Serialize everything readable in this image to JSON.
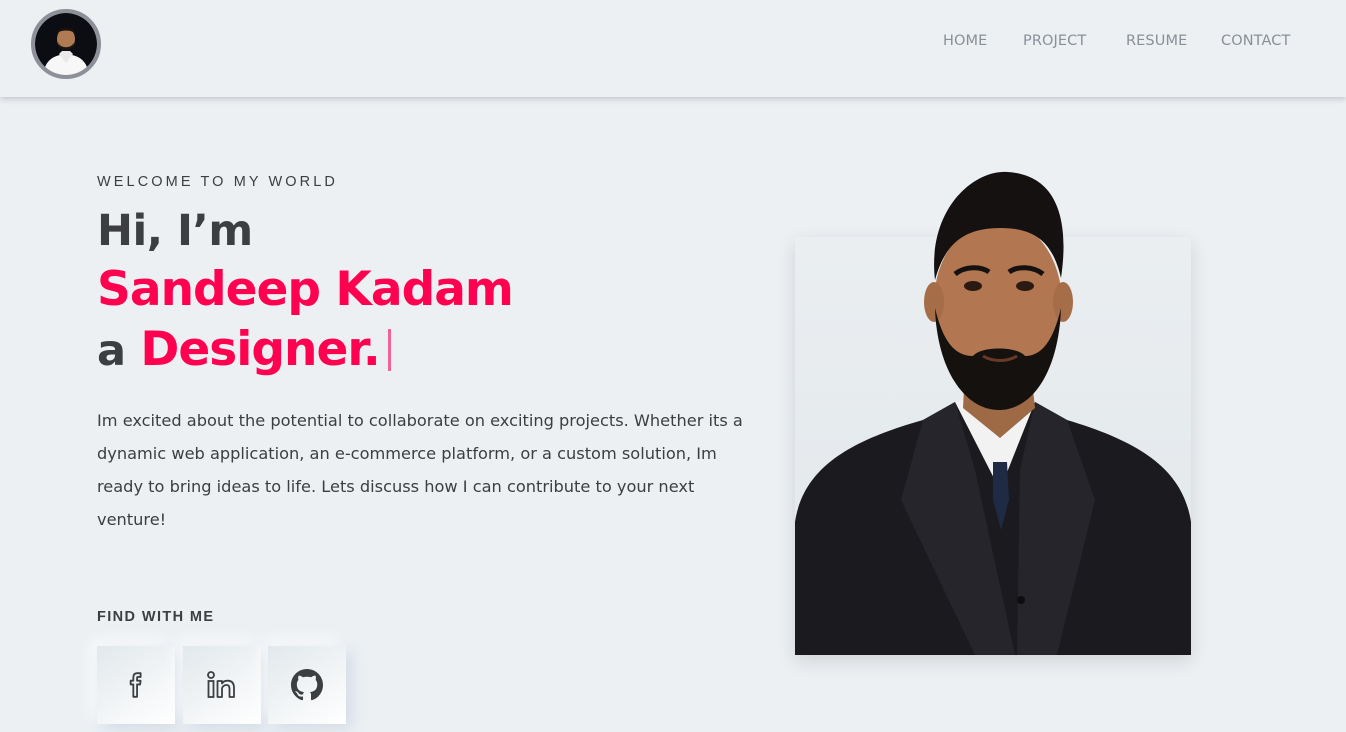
{
  "header": {
    "avatar_icon": "profile-photo",
    "nav": [
      {
        "label": "HOME"
      },
      {
        "label": "PROJECT"
      },
      {
        "label": "RESUME"
      },
      {
        "label": "CONTACT"
      }
    ]
  },
  "hero": {
    "welcome": "WELCOME TO MY WORLD",
    "greeting": "Hi, I’m",
    "name": "Sandeep Kadam",
    "prefix": "a",
    "role": "Designer.",
    "description": "Im excited about the potential to collaborate on exciting projects. Whether its a dynamic web application, an e-commerce platform, or a custom solution, Im ready to bring ideas to life. Lets discuss how I can contribute to your next venture!",
    "find_label": "FIND WITH ME",
    "social": [
      {
        "icon": "facebook-icon"
      },
      {
        "icon": "linkedin-icon"
      },
      {
        "icon": "github-icon"
      }
    ],
    "photo_icon": "profile-photo"
  },
  "colors": {
    "background": "#ecf0f3",
    "accent": "#ff014f",
    "text": "#3c3e41",
    "nav_text": "#8a8f98"
  }
}
